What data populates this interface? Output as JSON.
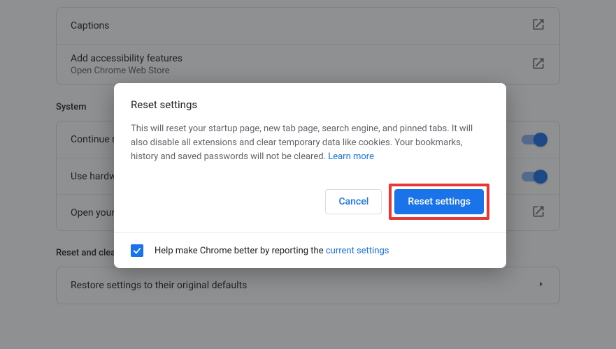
{
  "accessibility": {
    "captions": "Captions",
    "add_features_title": "Add accessibility features",
    "add_features_sub": "Open Chrome Web Store"
  },
  "system": {
    "heading": "System",
    "row1": "Continue running background apps when Google Chrome is closed",
    "row2": "Use hardware acceleration when available",
    "row3": "Open your computer's proxy settings"
  },
  "reset": {
    "heading": "Reset and clean up",
    "row1": "Restore settings to their original defaults"
  },
  "dialog": {
    "title": "Reset settings",
    "body_text": "This will reset your startup page, new tab page, search engine, and pinned tabs. It will also disable all extensions and clear temporary data like cookies. Your bookmarks, history and saved passwords will not be cleared. ",
    "learn_more": "Learn more",
    "cancel": "Cancel",
    "confirm": "Reset settings",
    "footer_prefix": "Help make Chrome better by reporting the ",
    "footer_link": "current settings",
    "checked": true
  }
}
